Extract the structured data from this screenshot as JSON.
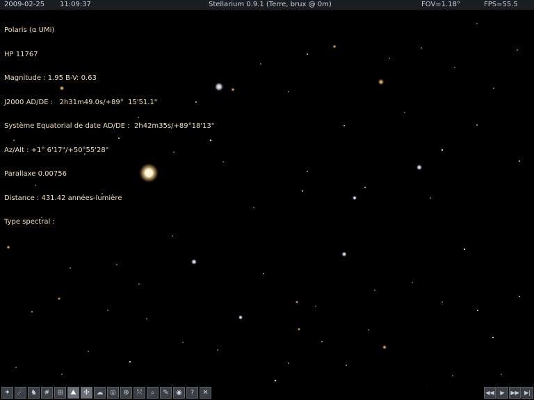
{
  "topbar": {
    "date": "2009-02-25",
    "time": "11:09:37",
    "title": "Stellarium 0.9.1 (Terre, brux @ 0m)",
    "fov": "FOV=1.18°",
    "fps": "FPS=55.5"
  },
  "info": {
    "lines": [
      "Polaris (α UMi)",
      "HP 11767",
      "Magnitude : 1.95 B-V: 0.63",
      "J2000 AD/DE :   2h31m49.0s/+89°  15'51.1\"",
      "Système Equatorial de date AD/DE :  2h42m35s/+89°18'13\"",
      "Az/Alt : +1° 6'17\"/+50°55'28\"",
      "Parallaxe 0.00756",
      "Distance : 431.42 années-lumière",
      "Type spectral :"
    ]
  },
  "toolbar": {
    "left_buttons": [
      {
        "name": "constellation-lines-button",
        "icon": "constellation-lines-icon",
        "glyph": "✶",
        "active": false
      },
      {
        "name": "constellation-names-button",
        "icon": "constellation-names-icon",
        "glyph": "☄",
        "active": false
      },
      {
        "name": "constellation-art-button",
        "icon": "constellation-art-icon",
        "glyph": "♞",
        "active": false
      },
      {
        "name": "equatorial-grid-button",
        "icon": "equatorial-grid-icon",
        "glyph": "#",
        "active": false
      },
      {
        "name": "azimuthal-grid-button",
        "icon": "azimuthal-grid-icon",
        "glyph": "⊞",
        "active": false
      },
      {
        "name": "ground-button",
        "icon": "ground-icon",
        "glyph": "⛰",
        "active": true
      },
      {
        "name": "cardinal-points-button",
        "icon": "cardinal-points-icon",
        "glyph": "✢",
        "active": true
      },
      {
        "name": "atmosphere-button",
        "icon": "atmosphere-icon",
        "glyph": "☁",
        "active": false
      },
      {
        "name": "nebulae-button",
        "icon": "nebulae-icon",
        "glyph": "◎",
        "active": false
      },
      {
        "name": "equatorial-mount-button",
        "icon": "equatorial-mount-icon",
        "glyph": "⊕",
        "active": false
      },
      {
        "name": "center-on-selection-button",
        "icon": "center-icon",
        "glyph": "⤧",
        "active": false
      },
      {
        "name": "search-button",
        "icon": "search-icon",
        "glyph": "⌕",
        "active": false
      },
      {
        "name": "configuration-button",
        "icon": "wrench-icon",
        "glyph": "✎",
        "active": false
      },
      {
        "name": "night-mode-button",
        "icon": "eye-icon",
        "glyph": "◉",
        "active": false
      },
      {
        "name": "help-button",
        "icon": "help-icon",
        "glyph": "?",
        "active": false
      },
      {
        "name": "quit-button",
        "icon": "close-icon",
        "glyph": "✕",
        "active": false
      }
    ],
    "time_buttons": [
      {
        "name": "rewind-button",
        "icon": "rewind-icon",
        "glyph": "◀◀"
      },
      {
        "name": "play-button",
        "icon": "play-icon",
        "glyph": "▶"
      },
      {
        "name": "fast-forward-button",
        "icon": "fast-forward-icon",
        "glyph": "▶▶"
      },
      {
        "name": "skip-forward-button",
        "icon": "skip-forward-icon",
        "glyph": "▶|"
      }
    ]
  }
}
